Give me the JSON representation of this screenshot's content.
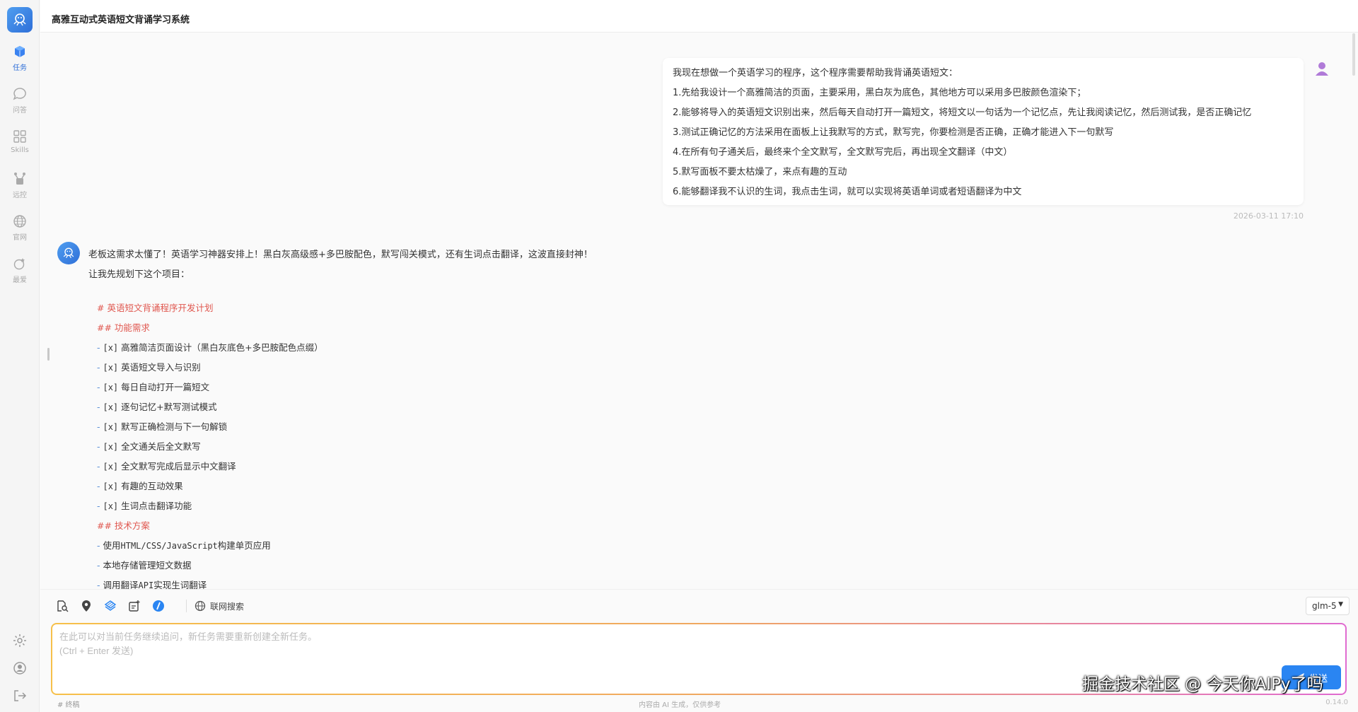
{
  "app": {
    "title": "高雅互动式英语短文背诵学习系统",
    "version": "0.14.0",
    "disclaimer": "内容由 AI 生成，仅供参考",
    "draft_label": "# 终稿"
  },
  "sidebar": {
    "items": [
      {
        "label": "任务",
        "icon": "cube-icon",
        "active": true
      },
      {
        "label": "问答",
        "icon": "chat-bubble-icon",
        "active": false
      },
      {
        "label": "Skills",
        "icon": "grid-icon",
        "active": false
      },
      {
        "label": "远控",
        "icon": "remote-control-icon",
        "active": false
      },
      {
        "label": "官网",
        "icon": "globe-icon",
        "active": false
      },
      {
        "label": "最爱",
        "icon": "favorite-icon",
        "active": false
      }
    ],
    "bottom_icons": [
      "settings-icon",
      "user-circle-icon",
      "logout-icon"
    ]
  },
  "chat": {
    "user_message": {
      "lines": [
        "我现在想做一个英语学习的程序，这个程序需要帮助我背诵英语短文：",
        "1.先给我设计一个高雅简洁的页面，主要采用，黑白灰为底色，其他地方可以采用多巴胺颜色渲染下；",
        "2.能够将导入的英语短文识别出来，然后每天自动打开一篇短文，将短文以一句话为一个记忆点，先让我阅读记忆，然后测试我，是否正确记忆",
        "3.测试正确记忆的方法采用在面板上让我默写的方式，默写完，你要检测是否正确，正确才能进入下一句默写",
        "4.在所有句子通关后，最终来个全文默写，全文默写完后，再出现全文翻译（中文）",
        "5.默写面板不要太枯燥了，来点有趣的互动",
        "6.能够翻译我不认识的生词，我点击生词，就可以实现将英语单词或者短语翻译为中文"
      ],
      "timestamp": "2026-03-11 17:10"
    },
    "ai_message": {
      "intro": [
        "老板这需求太懂了！英语学习神器安排上！黑白灰高级感+多巴胺配色，默写闯关模式，还有生词点击翻译，这波直接封神！",
        "让我先规划下这个项目："
      ],
      "plan_title": "# 英语短文背诵程序开发计划",
      "section_features": "## 功能需求",
      "features": [
        "高雅简洁页面设计（黑白灰底色+多巴胺配色点缀）",
        "英语短文导入与识别",
        "每日自动打开一篇短文",
        "逐句记忆+默写测试模式",
        "默写正确检测与下一句解锁",
        "全文通关后全文默写",
        "全文默写完成后显示中文翻译",
        "有趣的互动效果",
        "生词点击翻译功能"
      ],
      "checkbox": "[x]",
      "section_tech": "## 技术方案",
      "tech": [
        {
          "pre": "使用",
          "mono": "HTML/CSS/JavaScript",
          "post": "构建单页应用"
        },
        {
          "pre": "本地存储管理短文数据",
          "mono": "",
          "post": ""
        },
        {
          "pre": "调用翻译",
          "mono": "API",
          "post": "实现生词翻译"
        }
      ]
    }
  },
  "toolbar": {
    "tools": [
      "file-search-icon",
      "location-pin-icon",
      "stack-layers-icon",
      "add-note-icon",
      "slash-command-icon"
    ],
    "web_search_label": "联网搜索",
    "model": "glm-5"
  },
  "input": {
    "placeholder": "在此可以对当前任务继续追问，新任务需要重新创建全新任务。\n(Ctrl + Enter 发送)",
    "send_label": "发送"
  },
  "watermark": "掘金技术社区 @ 今天你AIPy了吗"
}
